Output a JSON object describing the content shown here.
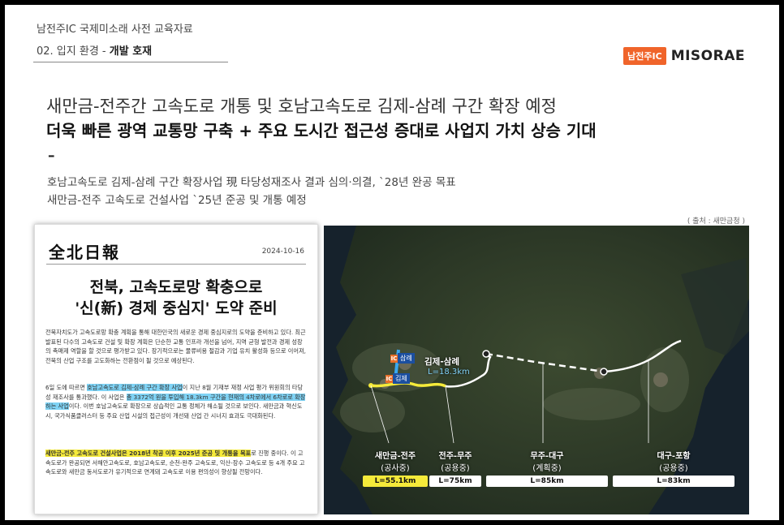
{
  "header": {
    "doc_title": "남전주IC 국제미소래 사전 교육자료",
    "section": "02. 입지 환경",
    "section_sep": " - ",
    "section_topic": "개발 호재"
  },
  "logo": {
    "badge": "남전주IC",
    "name": "MISORAE"
  },
  "headline": {
    "line1": "새만금-전주간 고속도로 개통 및 호남고속도로 김제-삼례 구간 확장 예정",
    "line2": "더욱 빠른 광역 교통망 구축 + 주요 도시간 접근성 증대로 사업지 가치 상승 기대",
    "dash": "–"
  },
  "summary": {
    "line1": "호남고속도로 김제-삼례 구간 확장사업 現 타당성재조사 결과 심의·의결, `28년 완공 목표",
    "line2": "새만금-전주 고속도로 건설사업 `25년 준공 및 개통 예정"
  },
  "source": "( 출처 : 새만금청 )",
  "newspaper": {
    "name": "全北日報",
    "date": "2024-10-16",
    "headline1": "전북, 고속도로망 확충으로",
    "headline2": "'신(新) 경제 중심지' 도약 준비",
    "p1": "전북자치도가 고속도로망 확충 계획을 통해 대한민국의 새로운 경제 중심지로의 도약을 준비하고 있다. 최근 발표된 다수의 고속도로 건설 및 확장 계획은 단순한 교통 인프라 개선을 넘어, 지역 균형 발전과 경제 성장의 촉매제 역할을 할 것으로 평가받고 있다. 장기적으로는 물류비용 절감과 기업 유치 활성화 등으로 이어져, 전북의 산업 구조를 고도화하는 전환점이 될 것으로 예상된다.",
    "p2a": "6일 도에 따르면 ",
    "p2_hl1": "호남고속도로 김제-삼례 구간 확장 사업",
    "p2b": "이 지난 8월 기재부 재정 사업 평가 위원회의 타당성 재조사를 통과했다. 이 사업은 ",
    "p2_hl2": "총 3372억 원을 투입해 18.3km 구간을 현재의 4차로에서 6차로로 확장하는 사업",
    "p2c": "이다. 이번 호남고속도로 확장으로 상습적인 교통 정체가 해소될 것으로 보인다. 새만금과 혁신도시, 국가식품클러스터 등 주요 산업 시설의 접근성이 개선돼 산업 간 시너지 효과도 극대화된다.",
    "p3_hl": "새만금-전주 고속도로 건설사업은 2018년 착공 이후 2025년 준공 및 개통을 목표",
    "p3b": "로 진행 중이다. 이 고속도로가 완공되면 서해안고속도로, 호남고속도로, 순천-완주 고속도로, 익산-장수 고속도로 등 4개 주요 고속도로와 새만금 동서도로가 유기적으로 연계돼 고속도로 이용 편의성이 향상될 전망이다."
  },
  "map": {
    "pin_samrye": "삼례",
    "pin_gimje": "김제",
    "pin_icon": "IC",
    "route_label": "김제-삼례",
    "route_length": "L=18.3km",
    "segments": [
      {
        "name": "새만금-전주",
        "status": "(공사중)",
        "length": "L=55.1km",
        "color": "#f5ea3a"
      },
      {
        "name": "전주-무주",
        "status": "(공용중)",
        "length": "L=75km",
        "color": "#ffffff"
      },
      {
        "name": "무주-대구",
        "status": "(계획중)",
        "length": "L=85km",
        "color": "#ffffff"
      },
      {
        "name": "대구-포항",
        "status": "(공용중)",
        "length": "L=83km",
        "color": "#ffffff"
      }
    ],
    "colors": {
      "yellow": "#f5ea3a",
      "blue": "#3aa8f0",
      "white": "#ffffff"
    }
  }
}
